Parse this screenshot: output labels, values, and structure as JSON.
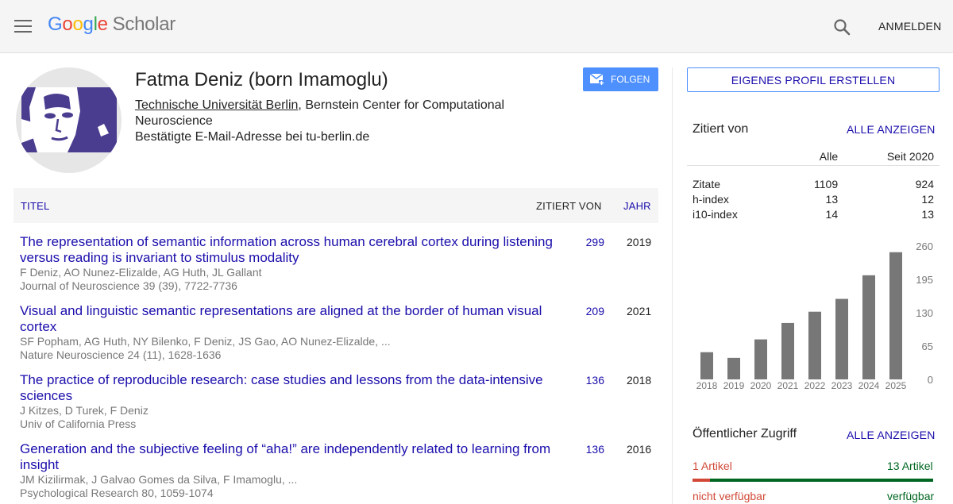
{
  "header": {
    "logo_letters": [
      "G",
      "o",
      "o",
      "g",
      "l",
      "e"
    ],
    "logo_suffix": "Scholar",
    "signin_label": "ANMELDEN"
  },
  "profile": {
    "name": "Fatma Deniz (born Imamoglu)",
    "affiliation_link": "Technische Universität Berlin",
    "affiliation_rest": ", Bernstein Center for Computational Neuroscience",
    "email": "Bestätigte E-Mail-Adresse bei tu-berlin.de",
    "follow_label": "FOLGEN"
  },
  "table": {
    "col_title": "TITEL",
    "col_cited": "ZITIERT VON",
    "col_year": "JAHR"
  },
  "articles": [
    {
      "title": "The representation of semantic information across human cerebral cortex during listening versus reading is invariant to stimulus modality",
      "authors": "F Deniz, AO Nunez-Elizalde, AG Huth, JL Gallant",
      "venue": "Journal of Neuroscience 39 (39), 7722-7736",
      "cites": "299",
      "year": "2019"
    },
    {
      "title": "Visual and linguistic semantic representations are aligned at the border of human visual cortex",
      "authors": "SF Popham, AG Huth, NY Bilenko, F Deniz, JS Gao, AO Nunez-Elizalde, ...",
      "venue": "Nature Neuroscience 24 (11), 1628-1636",
      "cites": "209",
      "year": "2021"
    },
    {
      "title": "The practice of reproducible research: case studies and lessons from the data-intensive sciences",
      "authors": "J Kitzes, D Turek, F Deniz",
      "venue": "Univ of California Press",
      "cites": "136",
      "year": "2018"
    },
    {
      "title": "Generation and the subjective feeling of “aha!” are independently related to learning from insight",
      "authors": "JM Kizilirmak, J Galvao Gomes da Silva, F Imamoglu, ...",
      "venue": "Psychological Research 80, 1059-1074",
      "cites": "136",
      "year": "2016"
    }
  ],
  "sidebar": {
    "create_profile_label": "EIGENES PROFIL ERSTELLEN",
    "cited_by_heading": "Zitiert von",
    "show_all_label": "ALLE ANZEIGEN",
    "col_all": "Alle",
    "col_since": "Seit 2020",
    "metrics": [
      {
        "label": "Zitate",
        "all": "1109",
        "since": "924"
      },
      {
        "label": "h-index",
        "all": "13",
        "since": "12"
      },
      {
        "label": "i10-index",
        "all": "14",
        "since": "13"
      }
    ],
    "access_heading": "Öffentlicher Zugriff",
    "access_show_all_label": "ALLE ANZEIGEN",
    "unavailable_count": "1 Artikel",
    "available_count": "13 Artikel",
    "unavailable_label": "nicht verfügbar",
    "available_label": "verfügbar",
    "unavailable_fraction": 0.0714,
    "colors": {
      "unavailable": "#d14836",
      "available": "#006621",
      "link": "#1a0dab",
      "bar": "#777777"
    }
  },
  "chart_data": {
    "type": "bar",
    "categories": [
      "2018",
      "2019",
      "2020",
      "2021",
      "2022",
      "2023",
      "2024",
      "2025"
    ],
    "values": [
      53,
      42,
      78,
      110,
      132,
      157,
      203,
      248
    ],
    "ylim": [
      0,
      260
    ],
    "yticks": [
      "260",
      "195",
      "130",
      "65",
      "0"
    ],
    "axis_side": "right",
    "grid": false
  }
}
